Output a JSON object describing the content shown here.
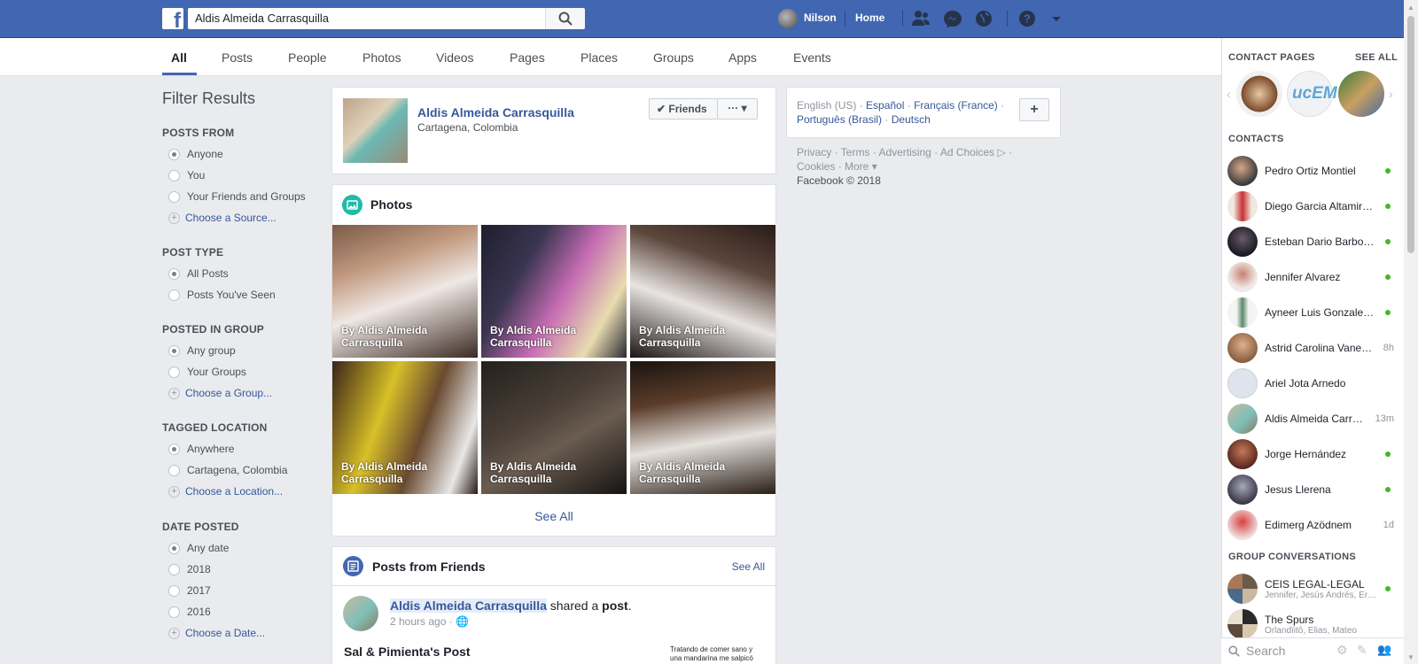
{
  "topbar": {
    "search_value": "Aldis Almeida Carrasquilla",
    "user_name": "Nilson",
    "home_label": "Home"
  },
  "tabs": [
    "All",
    "Posts",
    "People",
    "Photos",
    "Videos",
    "Pages",
    "Places",
    "Groups",
    "Apps",
    "Events"
  ],
  "filters": {
    "title": "Filter Results",
    "posts_from": {
      "heading": "POSTS FROM",
      "options": [
        "Anyone",
        "You",
        "Your Friends and Groups"
      ],
      "link": "Choose a Source..."
    },
    "post_type": {
      "heading": "POST TYPE",
      "options": [
        "All Posts",
        "Posts You've Seen"
      ]
    },
    "posted_in_group": {
      "heading": "POSTED IN GROUP",
      "options": [
        "Any group",
        "Your Groups"
      ],
      "link": "Choose a Group..."
    },
    "tagged_location": {
      "heading": "TAGGED LOCATION",
      "options": [
        "Anywhere",
        "Cartagena, Colombia"
      ],
      "link": "Choose a Location..."
    },
    "date_posted": {
      "heading": "DATE POSTED",
      "options": [
        "Any date",
        "2018",
        "2017",
        "2016"
      ],
      "link": "Choose a Date..."
    }
  },
  "profile": {
    "name": "Aldis Almeida Carrasquilla",
    "location": "Cartagena, Colombia",
    "friends_button": "Friends",
    "more_button": "···"
  },
  "photos": {
    "title": "Photos",
    "captions": [
      "By Aldis Almeida Carrasquilla",
      "By Aldis Almeida Carrasquilla",
      "By Aldis Almeida Carrasquilla",
      "By Aldis Almeida Carrasquilla",
      "By Aldis Almeida Carrasquilla",
      "By Aldis Almeida Carrasquilla"
    ],
    "see_all": "See All"
  },
  "posts_from_friends": {
    "title": "Posts from Friends",
    "see_all": "See All",
    "author": "Aldis Almeida Carrasquilla",
    "shared_a": "shared a",
    "post_word": "post",
    "time": "2 hours ago ·",
    "shared_title": "Sal & Pimienta's Post",
    "preview_text": "Tratando de comer sano y una mandarina me salpicó"
  },
  "right": {
    "languages": {
      "current": "English (US) ·",
      "espanol": "Español",
      "francais": "Français (France)",
      "portugues": "Português (Brasil)",
      "deutsch": "Deutsch",
      "dot": "·"
    },
    "footer_links": "Privacy · Terms · Advertising · Ad Choices ▷ ·",
    "footer_links2": "Cookies · More ▾",
    "copyright": "Facebook © 2018"
  },
  "chat": {
    "contact_pages": "CONTACT PAGES",
    "see_all": "SEE ALL",
    "contacts_heading": "CONTACTS",
    "group_heading": "GROUP CONVERSATIONS",
    "search_placeholder": "Search",
    "contacts": [
      {
        "name": "Pedro Ortiz Montiel",
        "status": "online"
      },
      {
        "name": "Diego Garcia Altamir…",
        "status": "online"
      },
      {
        "name": "Esteban Dario Barbo…",
        "status": "online"
      },
      {
        "name": "Jennifer Alvarez",
        "status": "online"
      },
      {
        "name": "Ayneer Luis Gonzale…",
        "status": "online"
      },
      {
        "name": "Astrid Carolina Vane…",
        "time": "8h"
      },
      {
        "name": "Ariel Jota Arnedo"
      },
      {
        "name": "Aldis Almeida Carr…",
        "time": "13m"
      },
      {
        "name": "Jorge Hernández",
        "status": "online"
      },
      {
        "name": "Jesus Llerena",
        "status": "online"
      },
      {
        "name": "Edimerg Azödnem",
        "time": "1d"
      }
    ],
    "groups": [
      {
        "name": "CEIS LEGAL-LEGAL",
        "members": "Jennifer, Jesús Andrés, Er…",
        "status": "online"
      },
      {
        "name": "The Spurs",
        "members": "Órlandïitô, Elias, Mateo"
      }
    ]
  },
  "colors": {
    "brand": "#4267b2",
    "link": "#365899",
    "online": "#42b72a",
    "background": "#e9ebee"
  }
}
